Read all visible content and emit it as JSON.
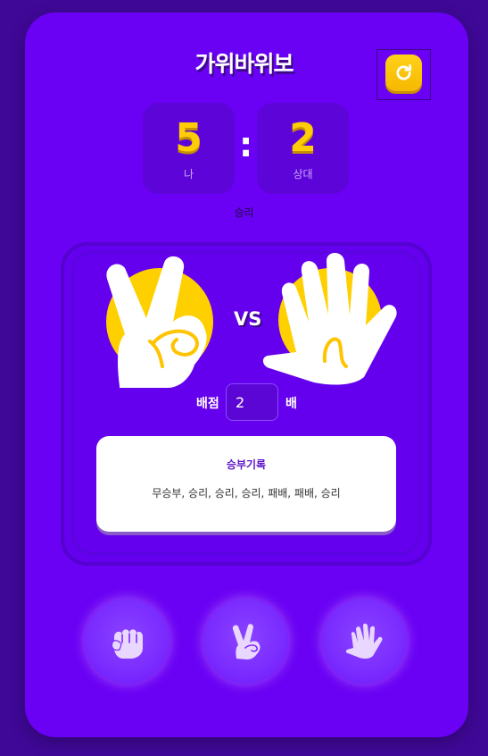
{
  "app": {
    "title": "가위바위보"
  },
  "score": {
    "me": {
      "value": "5",
      "label": "나"
    },
    "separator": ":",
    "opponent": {
      "value": "2",
      "label": "상대"
    }
  },
  "result_text": "승리",
  "arena": {
    "my_choice": "scissors",
    "opponent_choice": "paper",
    "vs_label": "VS"
  },
  "bet": {
    "label": "배점",
    "value": "2",
    "unit": "배"
  },
  "record": {
    "title": "승부기록",
    "text": "무승부, 승리, 승리, 승리, 패배, 패배, 승리"
  },
  "choices": [
    {
      "name": "rock-icon"
    },
    {
      "name": "scissors-icon"
    },
    {
      "name": "paper-icon"
    }
  ],
  "colors": {
    "background": "#3f0897",
    "card": "#6a00f4",
    "accent": "#ffcd05",
    "button": "#8a43ff"
  }
}
